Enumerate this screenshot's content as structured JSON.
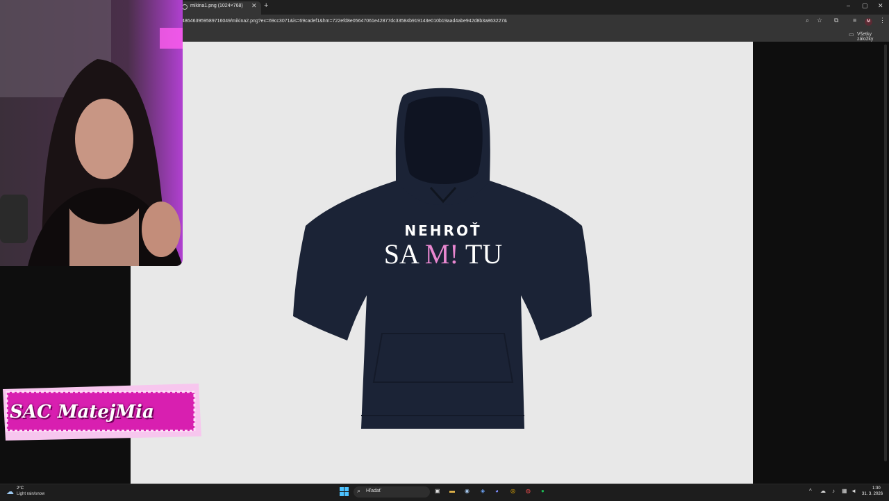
{
  "browser": {
    "tab_title": "mikina1.png (1024×768)",
    "tab_close": "✕",
    "new_tab": "+",
    "window_controls": [
      "–",
      "▢",
      "✕"
    ],
    "url": "486463959589716049/mikina2.png?ex=69cc3071&is=69cadef1&hm=722efd8e05647061e42877dc33584b919143e010b19aad4abe942d8b3a863227&",
    "toolbar_icons": [
      "zoom-icon",
      "star-icon",
      "extensions-icon",
      "media-icon",
      "menu-icon"
    ],
    "profile_initial": "M",
    "bookmarks_label": "Všetky záložky"
  },
  "image": {
    "print_line1": "NEHROŤ",
    "print_line2_a": "SA ",
    "print_line2_b": "M!",
    "print_line2_c": " TU",
    "garment_color": "#1b2336",
    "accent_color": "#e987d0"
  },
  "overlay": {
    "channel_name": "SAC MatejMia",
    "label_color": "#d81fb0"
  },
  "taskbar": {
    "temperature": "2°C",
    "weather": "Light rain/snow",
    "search_placeholder": "Hľadať",
    "clock_time": "1:30",
    "clock_date": "31. 3. 2026"
  }
}
